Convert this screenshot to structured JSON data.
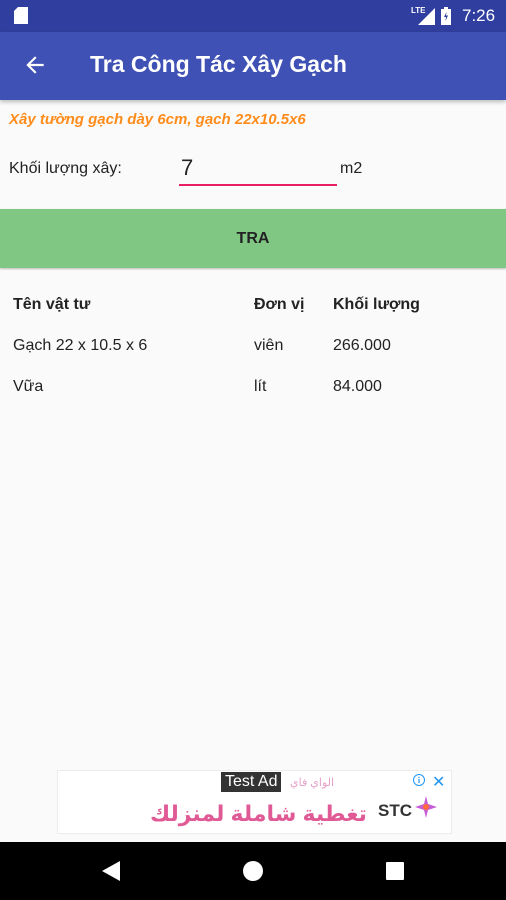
{
  "status_bar": {
    "network": "LTE",
    "time": "7:26"
  },
  "app_bar": {
    "title": "Tra Công Tác Xây Gạch",
    "back_icon": "arrow-back-icon"
  },
  "form": {
    "subtitle": "Xây tường gạch dày 6cm, gạch 22x10.5x6",
    "quantity_label": "Khối lượng xây:",
    "quantity_value": "7",
    "quantity_unit": "m2",
    "submit_label": "TRA"
  },
  "results": {
    "headers": [
      "Tên vật tư",
      "Đơn vị",
      "Khối lượng"
    ],
    "rows": [
      [
        "Gạch 22 x 10.5 x 6",
        "viên",
        "266.000"
      ],
      [
        "Vữa",
        "lít",
        "84.000"
      ]
    ]
  },
  "ad": {
    "label": "Test Ad",
    "small_text": "الواي فاي",
    "main_text": "تغطية شاملة لمنزلك",
    "brand": "STC"
  },
  "colors": {
    "status_bar": "#303f9f",
    "app_bar": "#3f51b5",
    "accent": "#e91e63",
    "subtitle": "#ff8c1a",
    "button": "#81c784"
  }
}
